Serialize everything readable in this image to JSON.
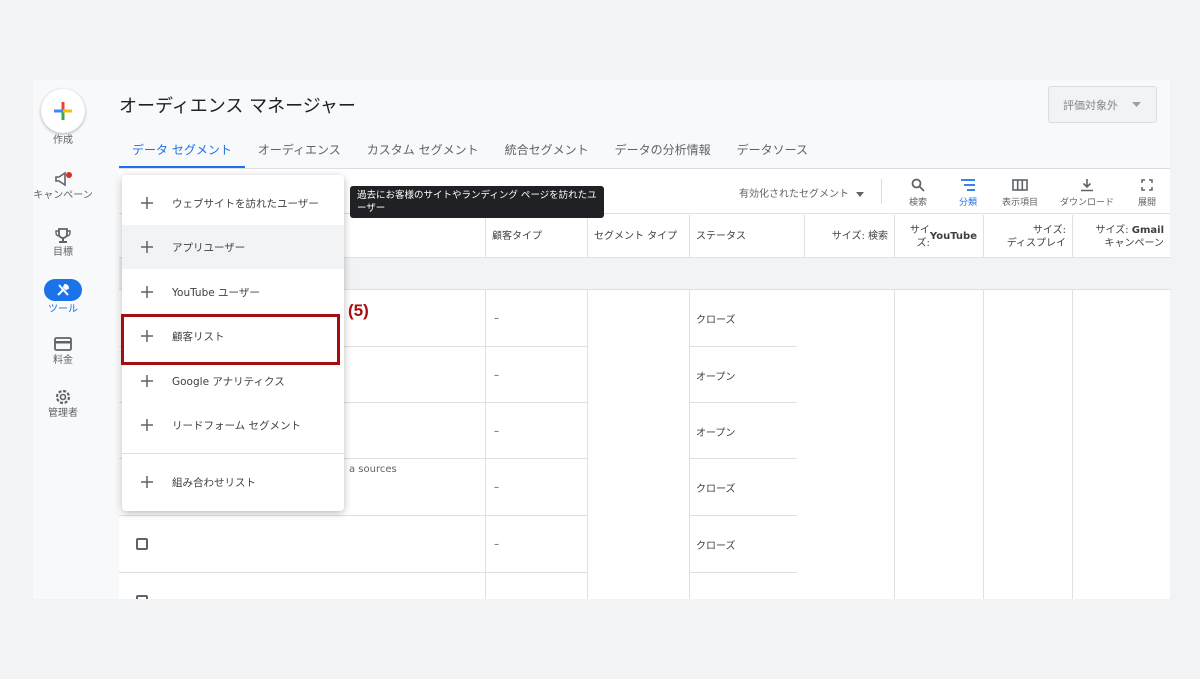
{
  "rail": {
    "create": "作成",
    "campaigns": "キャンペーン",
    "goals": "目標",
    "tools": "ツール",
    "billing": "料金",
    "admin": "管理者"
  },
  "header": {
    "title": "オーディエンス マネージャー",
    "eval_button": "評価対象外"
  },
  "tabs": [
    {
      "label": "データ セグメント",
      "active": true
    },
    {
      "label": "オーディエンス"
    },
    {
      "label": "カスタム セグメント"
    },
    {
      "label": "統合セグメント"
    },
    {
      "label": "データの分析情報"
    },
    {
      "label": "データソース"
    }
  ],
  "toolbar": {
    "filter": "有効化されたセグメント",
    "search": "検索",
    "segment": "分類",
    "columns": "表示項目",
    "download": "ダウンロード",
    "expand": "展開"
  },
  "columns": {
    "customer_type": "顧客タイプ",
    "segment_type": "セグメント タイプ",
    "status": "ステータス",
    "size_search": "サイズ: 検索",
    "size_youtube_prefix": "サイズ: ",
    "size_youtube_bold": "YouTube",
    "size_display_1": "サイズ:",
    "size_display_2": "ディスプレイ",
    "size_gmail_prefix": "サイズ: ",
    "size_gmail_bold": "Gmail",
    "size_gmail_2": "キャンペーン"
  },
  "rows": [
    {
      "customer_type": "–",
      "status": "クローズ"
    },
    {
      "customer_type": "–",
      "status": "オープン",
      "desc": "a sources"
    },
    {
      "customer_type": "–",
      "status": "オープン"
    },
    {
      "customer_type": "–",
      "status": "クローズ"
    },
    {
      "customer_type": "–",
      "status": "クローズ"
    }
  ],
  "menu": {
    "items": [
      "ウェブサイトを訪れたユーザー",
      "アプリユーザー",
      "YouTube ユーザー",
      "顧客リスト",
      "Google アナリティクス",
      "リードフォーム セグメント"
    ],
    "combined": "組み合わせリスト"
  },
  "tooltip": "過去にお客様のサイトやランディング ページを訪れたユーザー",
  "annotation": "(5)",
  "colors": {
    "accent": "#1a73e8",
    "highlight": "#a50e0e"
  }
}
